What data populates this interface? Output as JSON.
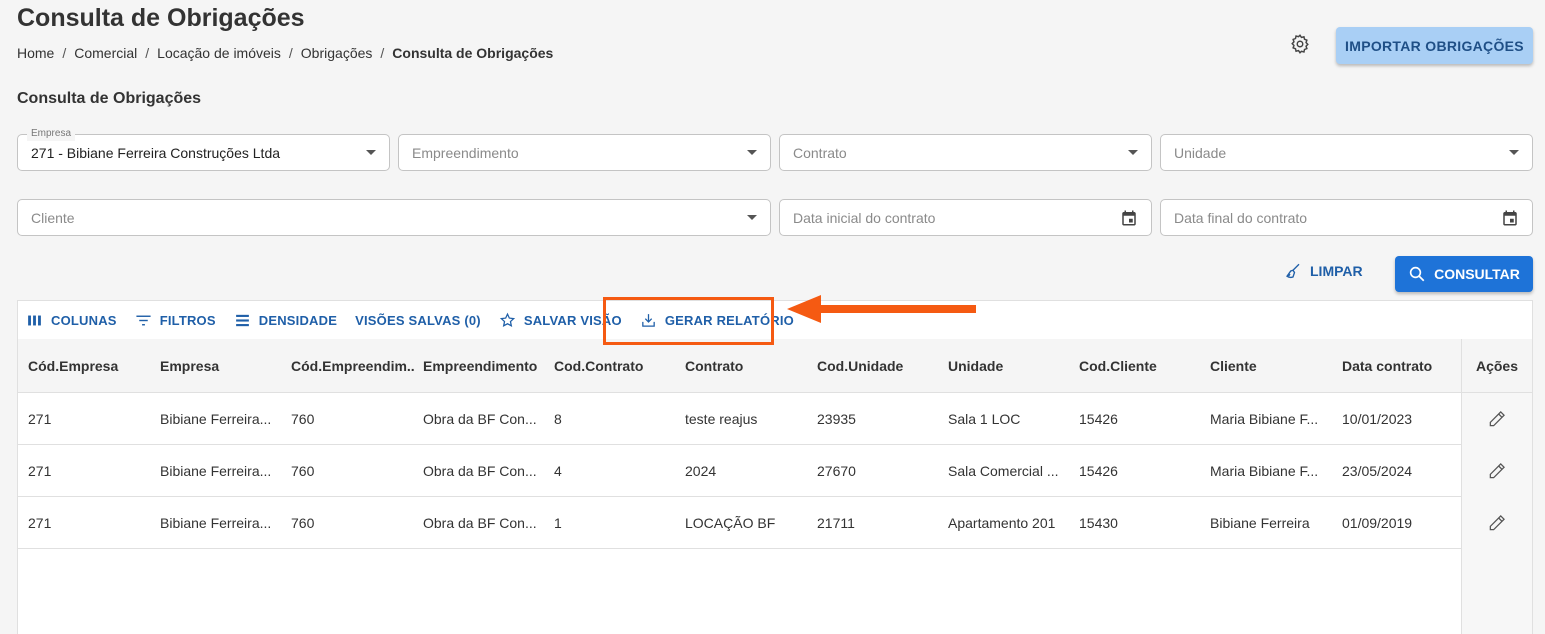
{
  "page": {
    "title": "Consulta de Obrigações",
    "breadcrumb": [
      "Home",
      "Comercial",
      "Locação de imóveis",
      "Obrigações",
      "Consulta de Obrigações"
    ],
    "settings_icon": "gear-icon",
    "import_label": "IMPORTAR OBRIGAÇÕES"
  },
  "filters": {
    "section_title": "Consulta de Obrigações",
    "empresa_label": "Empresa",
    "empresa_value": "271 - Bibiane Ferreira Construções Ltda",
    "empreendimento_placeholder": "Empreendimento",
    "contrato_placeholder": "Contrato",
    "unidade_placeholder": "Unidade",
    "cliente_placeholder": "Cliente",
    "data_inicial_placeholder": "Data inicial do contrato",
    "data_final_placeholder": "Data final do contrato",
    "limpar_label": "LIMPAR",
    "consultar_label": "CONSULTAR"
  },
  "toolbar": {
    "colunas": "COLUNAS",
    "filtros": "FILTROS",
    "densidade": "DENSIDADE",
    "visoes_salvas": "VISÕES SALVAS (0)",
    "salvar_visao": "SALVAR VISÃO",
    "gerar_relatorio": "GERAR RELATÓRIO"
  },
  "table": {
    "columns": [
      "Cód.Empresa",
      "Empresa",
      "Cód.Empreendim...",
      "Empreendimento",
      "Cod.Contrato",
      "Contrato",
      "Cod.Unidade",
      "Unidade",
      "Cod.Cliente",
      "Cliente",
      "Data contrato"
    ],
    "actions_header": "Ações",
    "rows": [
      [
        "271",
        "Bibiane Ferreira...",
        "760",
        "Obra da BF Con...",
        "8",
        "teste reajus",
        "23935",
        "Sala 1 LOC",
        "15426",
        "Maria Bibiane F...",
        "10/01/2023"
      ],
      [
        "271",
        "Bibiane Ferreira...",
        "760",
        "Obra da BF Con...",
        "4",
        "2024",
        "27670",
        "Sala Comercial ...",
        "15426",
        "Maria Bibiane F...",
        "23/05/2024"
      ],
      [
        "271",
        "Bibiane Ferreira...",
        "760",
        "Obra da BF Con...",
        "1",
        "LOCAÇÃO BF",
        "21711",
        "Apartamento 201",
        "15430",
        "Bibiane Ferreira",
        "01/09/2019"
      ]
    ]
  },
  "colors": {
    "accent": "#1e73d8",
    "highlight": "#f55a12"
  }
}
